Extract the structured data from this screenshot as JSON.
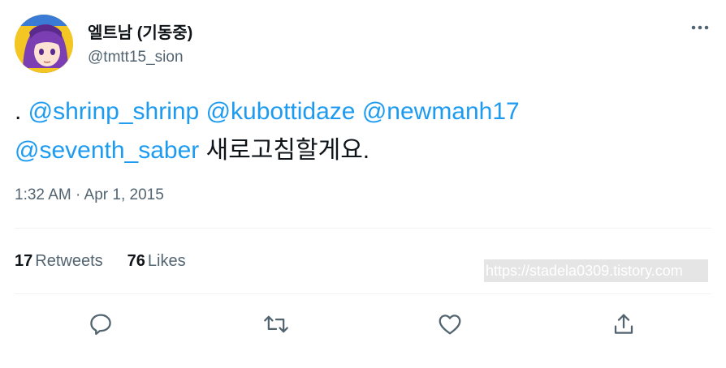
{
  "author": {
    "display_name": "엘트남 (기동중)",
    "handle": "@tmtt15_sion",
    "avatar_icon": "anime-avatar-purple-hair"
  },
  "tweet": {
    "text_prefix": ". ",
    "mentions": [
      "@shrinp_shrinp",
      "@kubottidaze",
      "@newmanh17",
      "@seventh_saber"
    ],
    "text_body": " 새로고침할게요.",
    "timestamp": "1:32 AM · Apr 1, 2015"
  },
  "stats": {
    "retweets_count": "17",
    "retweets_label": "Retweets",
    "likes_count": "76",
    "likes_label": "Likes"
  },
  "watermark": {
    "text": "https://stadela0309.tistory.com"
  },
  "actions": {
    "reply_icon": "reply-icon",
    "retweet_icon": "retweet-icon",
    "like_icon": "heart-icon",
    "share_icon": "share-icon",
    "more_icon": "more-options-icon"
  },
  "colors": {
    "mention": "#1d9bf0",
    "secondary_text": "#536471",
    "primary_text": "#0f1419",
    "divider": "#eff3f4"
  }
}
